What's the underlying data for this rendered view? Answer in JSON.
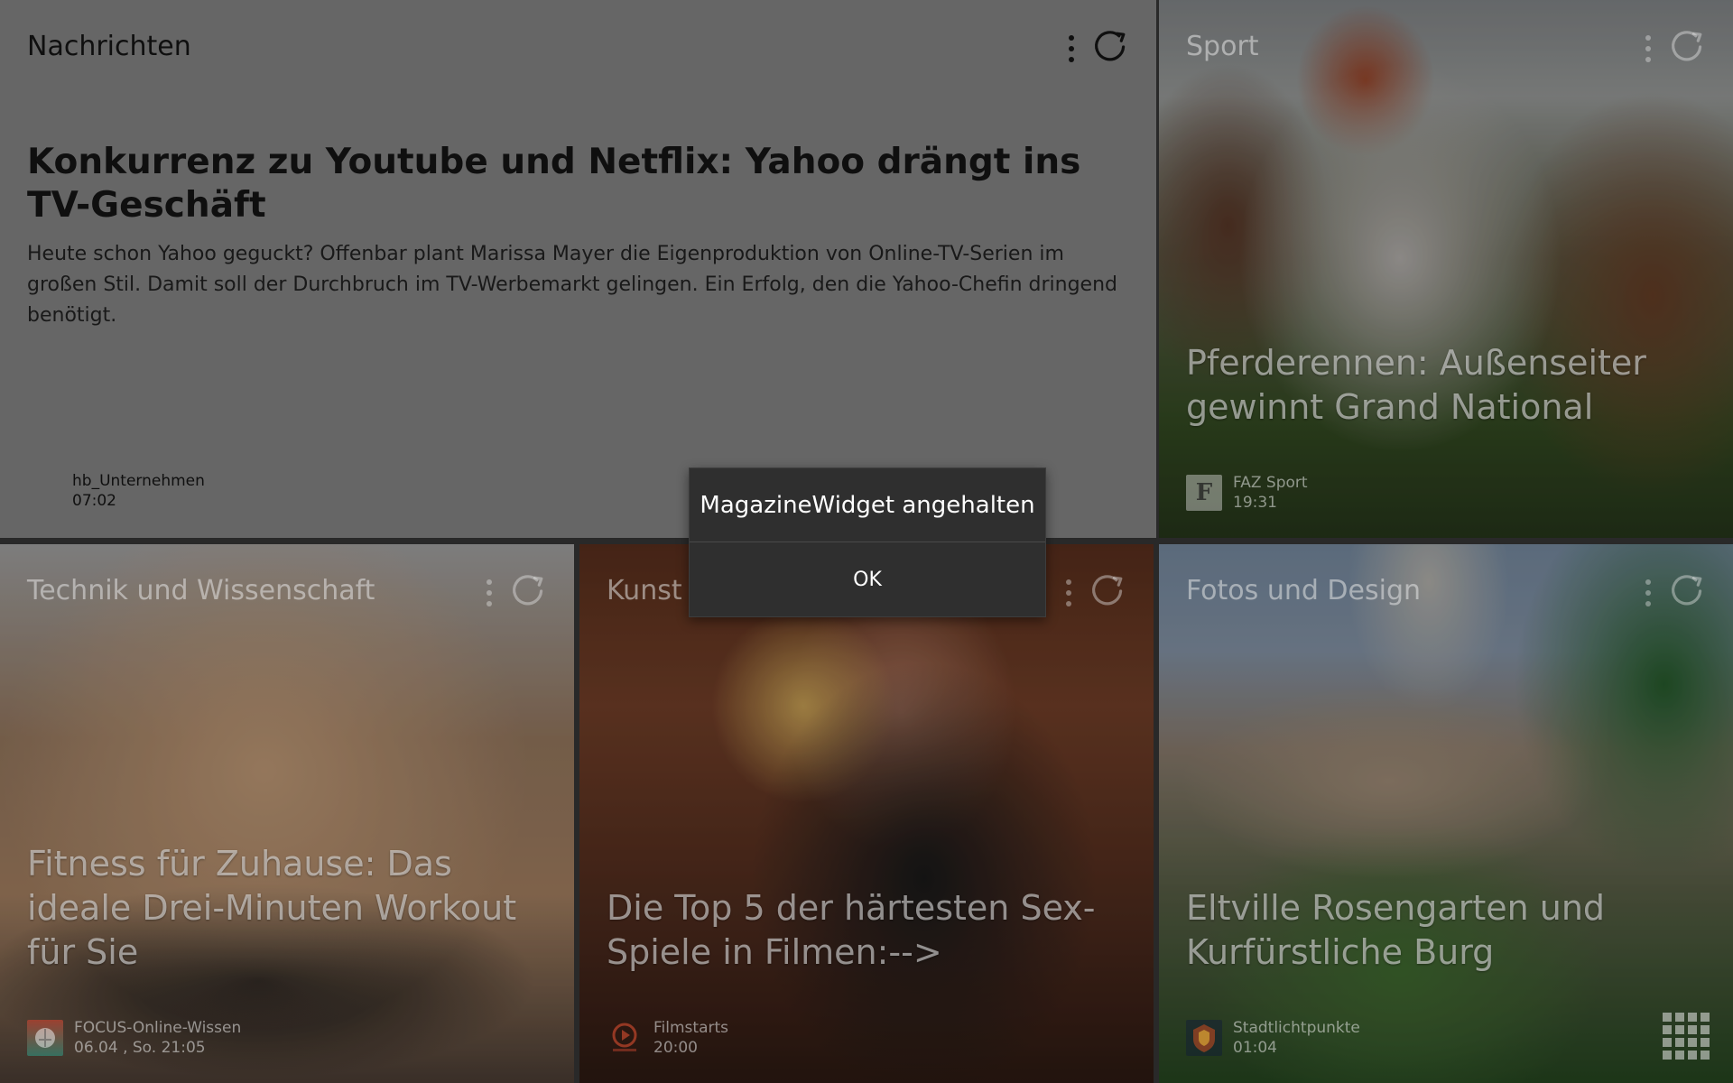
{
  "tiles": {
    "news": {
      "title": "Nachrichten",
      "headline": "Konkurrenz zu Youtube und Netflix: Yahoo drängt ins TV-Geschäft",
      "summary": "Heute schon Yahoo geguckt? Offenbar plant Marissa Mayer die Eigenproduktion von Online-TV-Serien im großen Stil. Damit soll der Durchbruch im TV-Werbemarkt gelingen. Ein Erfolg, den die Yahoo-Chefin dringend benötigt.",
      "source": "hb_Unternehmen",
      "time": "07:02"
    },
    "sport": {
      "title": "Sport",
      "headline": "Pferderennen: Außenseiter gewinnt Grand National",
      "source": "FAZ Sport",
      "time": "19:31",
      "logo_text": "F"
    },
    "tech": {
      "title": "Technik und Wissenschaft",
      "headline": "Fitness für Zuhause: Das ideale Drei-Minuten Workout für Sie",
      "source": "FOCUS-Online-Wissen",
      "time": "06.04 , So. 21:05"
    },
    "art": {
      "title": "Kunst",
      "headline": "Die Top 5 der härtesten Sex-Spiele in Filmen:-->",
      "source": "Filmstarts",
      "time": "20:00"
    },
    "photo": {
      "title": "Fotos und Design",
      "headline": "Eltville Rosengarten und Kurfürstliche Burg",
      "source": "Stadtlichtpunkte",
      "time": "01:04"
    }
  },
  "dialog": {
    "title": "MagazineWidget angehalten",
    "ok_label": "OK"
  },
  "icons": {
    "menu": "overflow-menu-icon",
    "refresh": "refresh-icon",
    "apps": "app-grid-icon"
  },
  "colors": {
    "dialog_bg": "#2f2f2f",
    "news_bg": "#6f6f6f"
  }
}
